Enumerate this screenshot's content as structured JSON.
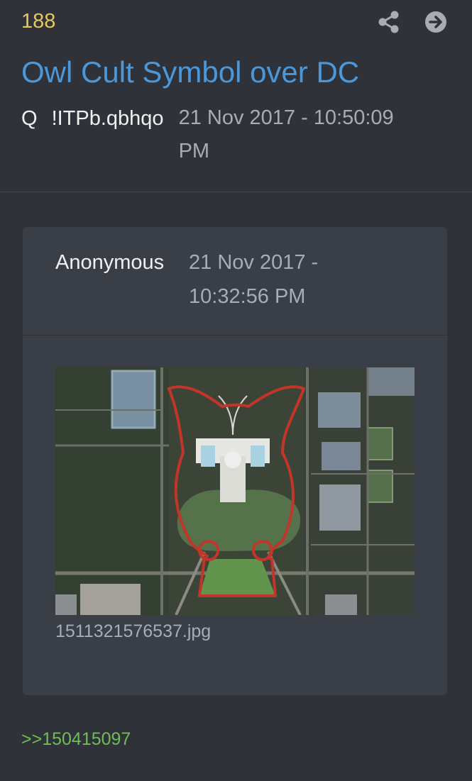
{
  "post": {
    "number": "188",
    "title": "Owl Cult Symbol over DC",
    "author_name": "Q",
    "tripcode": "!ITPb.qbhqo",
    "timestamp": "21 Nov 2017 - 10:50:09 PM",
    "share_icon": "share-icon",
    "next_icon": "arrow-right-circle-icon"
  },
  "quoted_post": {
    "author": "Anonymous",
    "timestamp": "21 Nov 2017 - 10:32:56 PM",
    "image_filename": "1511321576537.jpg"
  },
  "reply_link": {
    "text": ">>150415097"
  },
  "colors": {
    "background": "#2f3239",
    "card": "#3a3e47",
    "post_number": "#e7c85b",
    "title": "#4a97da",
    "muted_text": "#a7acb5",
    "link_green": "#6fbd55",
    "owl_outline": "#c2352b"
  }
}
